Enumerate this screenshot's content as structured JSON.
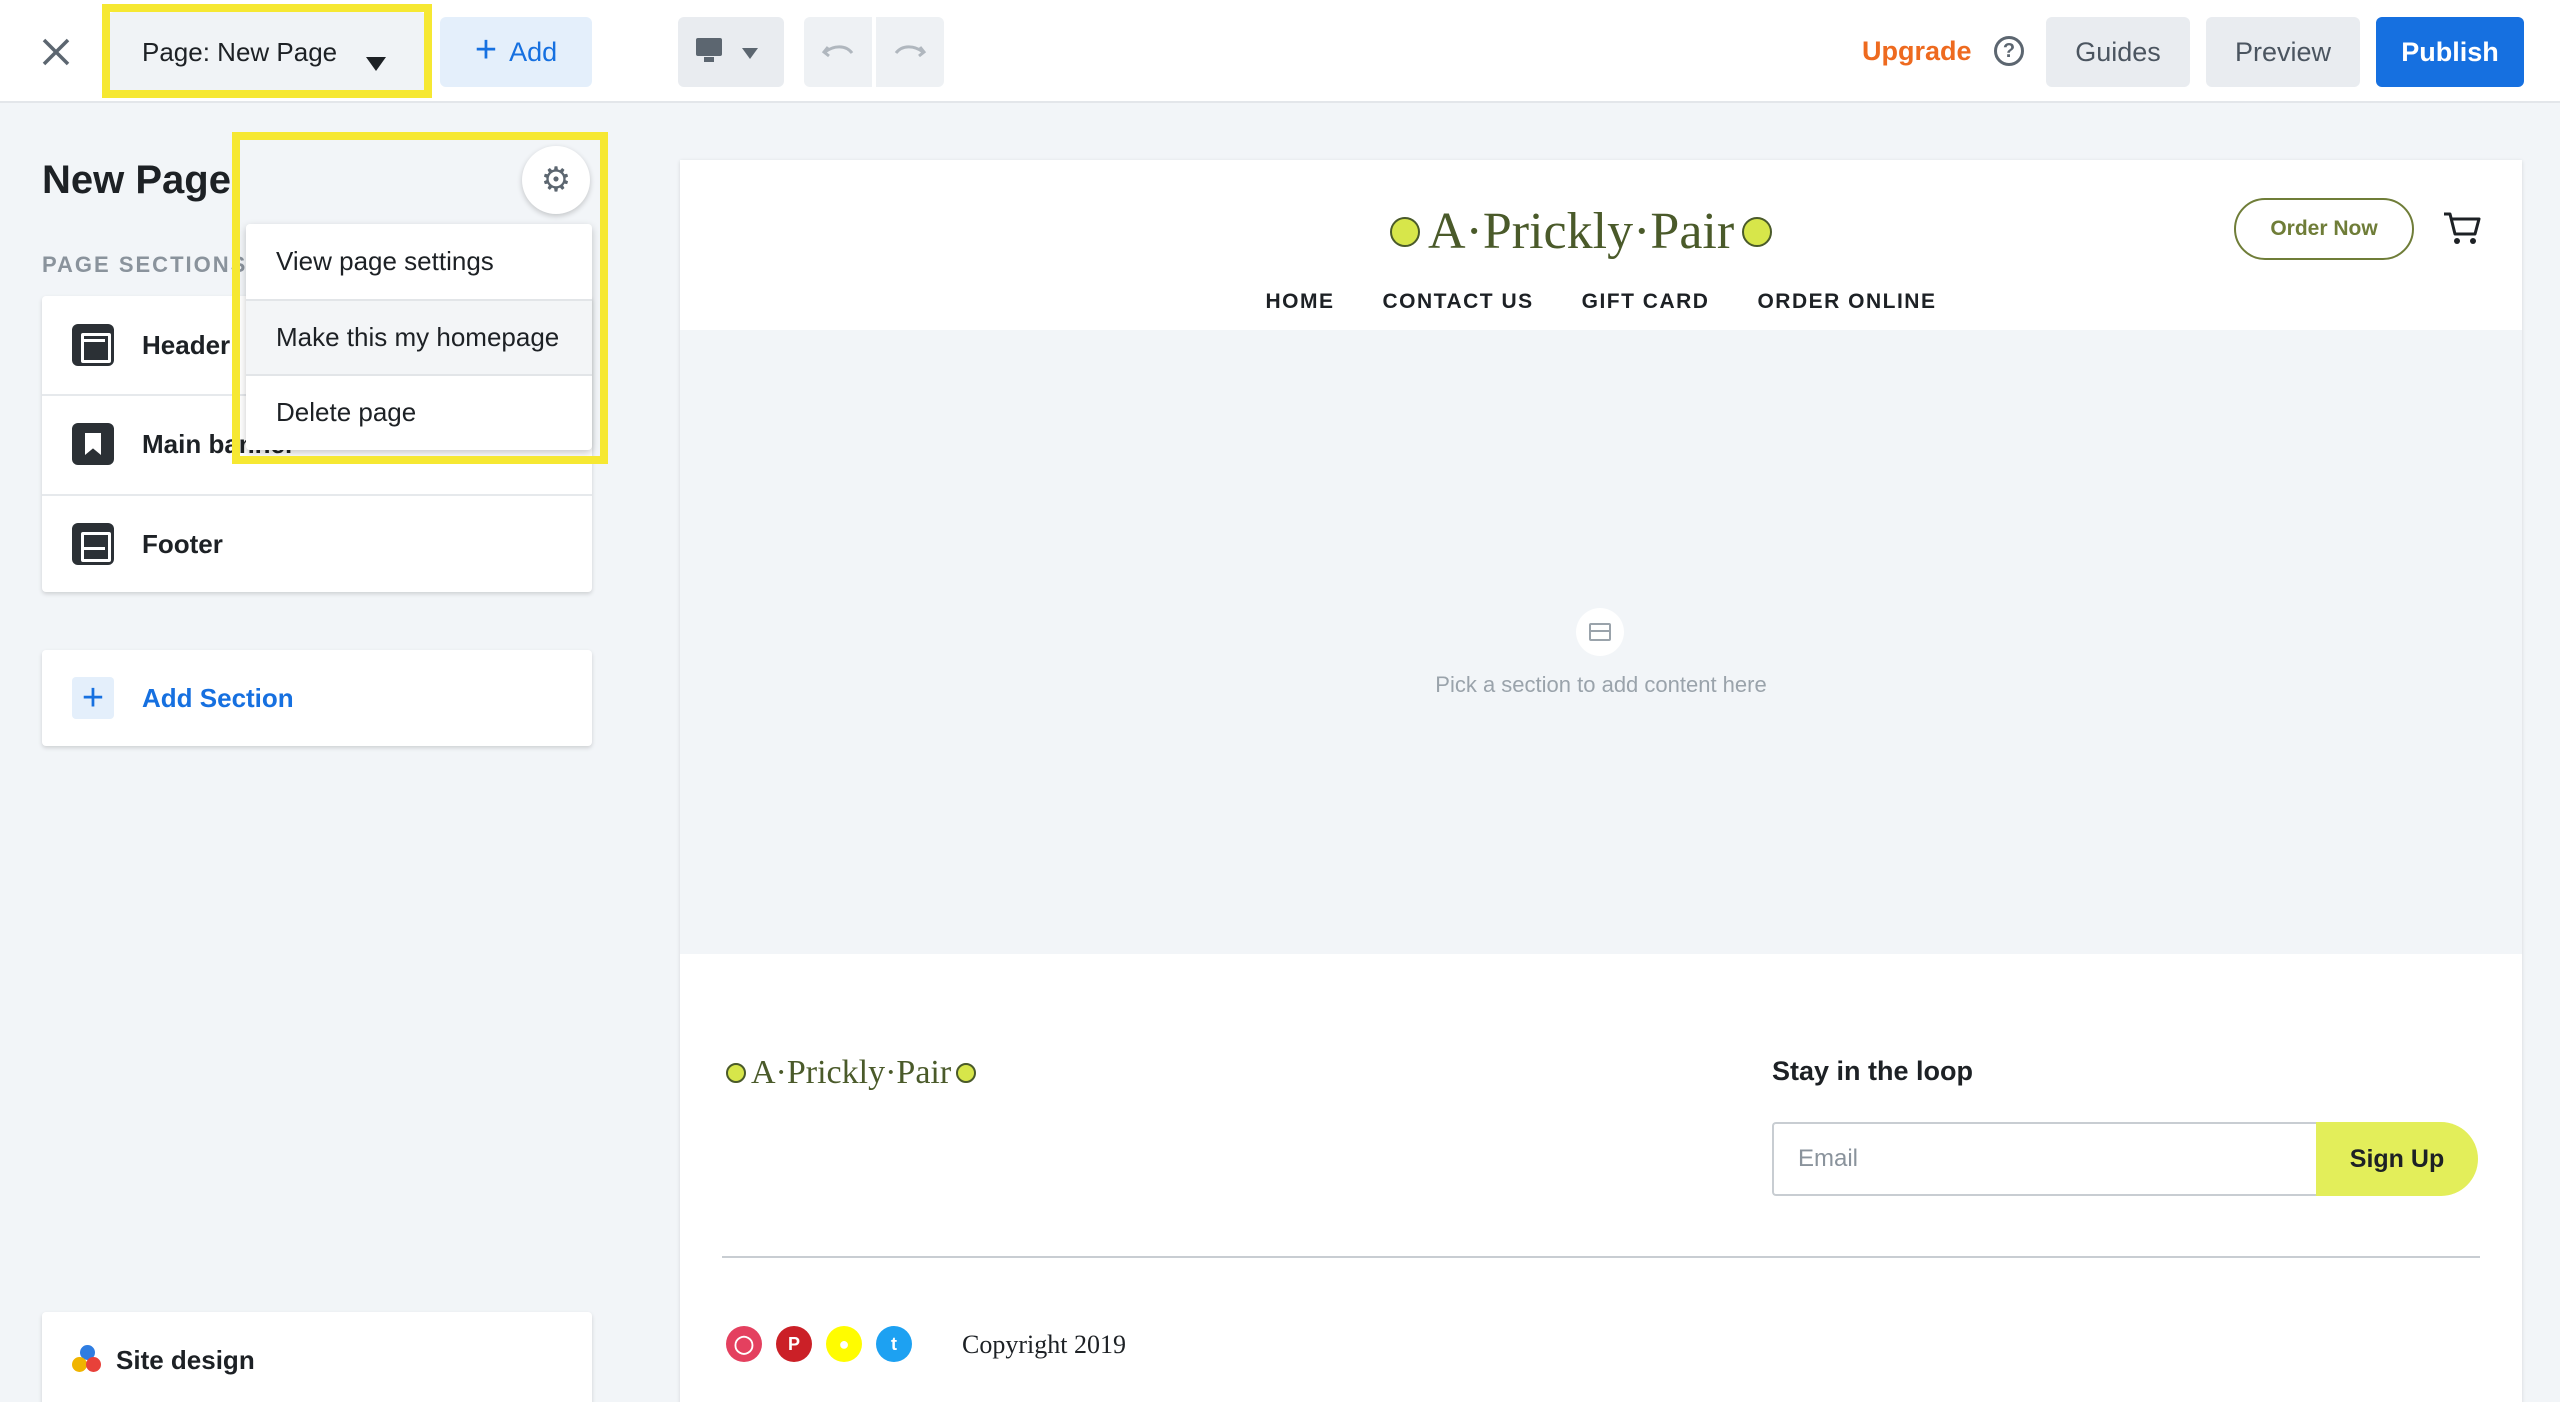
{
  "topbar": {
    "page_select_label": "Page: New Page",
    "add_label": "Add",
    "upgrade_label": "Upgrade",
    "help_glyph": "?",
    "guides_label": "Guides",
    "preview_label": "Preview",
    "publish_label": "Publish"
  },
  "panel": {
    "title": "New Page",
    "sections_heading": "PAGE SECTIONS",
    "sections": [
      {
        "label": "Header",
        "icon": "header-section-icon"
      },
      {
        "label": "Main banner",
        "icon": "banner-section-icon"
      },
      {
        "label": "Footer",
        "icon": "footer-section-icon"
      }
    ],
    "add_section_label": "Add Section",
    "site_design_label": "Site design"
  },
  "page_menu": {
    "items": [
      "View page settings",
      "Make this my homepage",
      "Delete page"
    ]
  },
  "site": {
    "logo_text": "A·Prickly·Pair",
    "order_now_label": "Order Now",
    "nav": [
      "HOME",
      "CONTACT US",
      "GIFT CARD",
      "ORDER ONLINE"
    ],
    "empty_section_text": "Pick a section to add content here",
    "newsletter_heading": "Stay in the loop",
    "email_placeholder": "Email",
    "signup_label": "Sign Up",
    "social_icons": [
      "instagram-icon",
      "pinterest-icon",
      "snapchat-icon",
      "twitter-icon"
    ],
    "copyright": "Copyright 2019"
  },
  "colors": {
    "accent_blue": "#1670e0",
    "upgrade_orange": "#ee6a1f",
    "highlight_yellow": "#f6e832",
    "signup_green": "#e3ee5a",
    "brand_olive": "#6f7d38"
  }
}
